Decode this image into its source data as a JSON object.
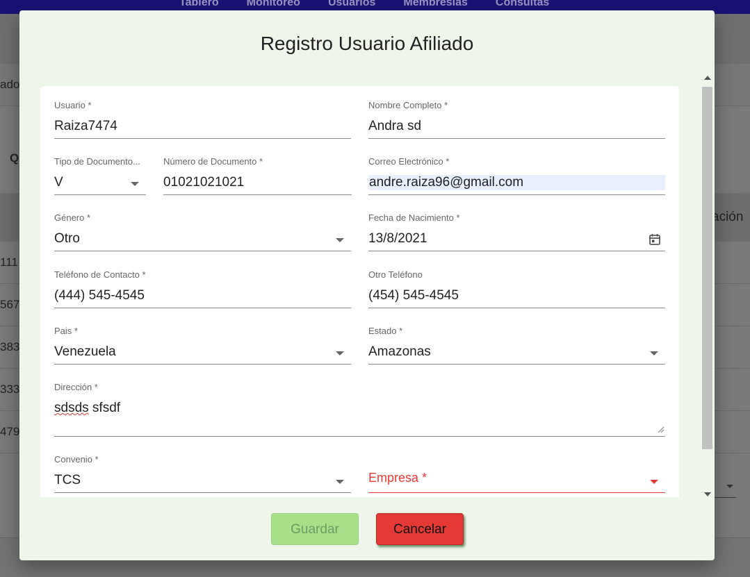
{
  "background": {
    "nav": [
      "Tablero",
      "Monitoreo",
      "Usuarios",
      "Membresias",
      "Consultas"
    ],
    "side_text_1": "ado",
    "side_text_2": "Q",
    "header_right": "ación",
    "row_fragments": [
      "111",
      "567",
      "383",
      "333",
      "479"
    ]
  },
  "dialog": {
    "title": "Registro Usuario Afiliado",
    "fields": {
      "usuario": {
        "label": "Usuario *",
        "value": "Raiza7474"
      },
      "nombre": {
        "label": "Nombre Completo *",
        "value": "Andra sd"
      },
      "tipo_doc": {
        "label": "Tipo de Documento...",
        "value": "V"
      },
      "num_doc": {
        "label": "Número de Documento *",
        "value": "01021021021"
      },
      "correo": {
        "label": "Correo Electrónico *",
        "value": "andre.raiza96@gmail.com"
      },
      "genero": {
        "label": "Género *",
        "value": "Otro"
      },
      "fecha": {
        "label": "Fecha de Nacimiento *",
        "value": "13/8/2021"
      },
      "telefono": {
        "label": "Teléfono de Contacto *",
        "value": "(444) 545-4545"
      },
      "otro_tel": {
        "label": "Otro Teléfono",
        "value": "(454) 545-4545"
      },
      "pais": {
        "label": "Pais *",
        "value": "Venezuela"
      },
      "estado": {
        "label": "Estado *",
        "value": "Amazonas"
      },
      "direccion": {
        "label": "Dirección *",
        "value_word1": "sdsds",
        "value_word2": "sfsdf"
      },
      "convenio": {
        "label": "Convenio *",
        "value": "TCS"
      },
      "empresa": {
        "label": "Empresa *"
      }
    },
    "buttons": {
      "save": "Guardar",
      "cancel": "Cancelar"
    }
  },
  "colors": {
    "error": "#e53935",
    "save_button": "#a8e08a",
    "dialog_bg": "#eef6ea",
    "topbar": "#1a1275"
  },
  "icons": {
    "date": "calendar-icon",
    "dropdown": "caret-down-icon"
  }
}
